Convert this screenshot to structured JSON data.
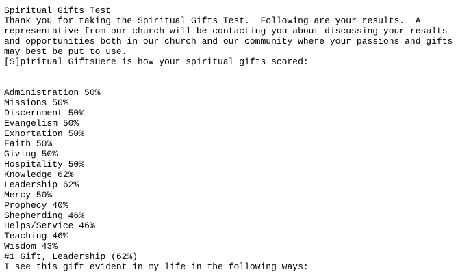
{
  "title": "Spiritual Gifts Test",
  "intro_lines": [
    "Thank you for taking the Spiritual Gifts Test.  Following are your results.  A",
    "representative from our church will be contacting you about discussing your results",
    "and opportunities both in our church and our community where your passions and gifts",
    "may best be put to use."
  ],
  "section_heading": "[S]piritual GiftsHere is how your spiritual gifts scored:",
  "gifts": [
    {
      "name": "Administration",
      "score": "50%",
      "text": "Administration 50%"
    },
    {
      "name": "Missions",
      "score": "50%",
      "text": "Missions 50%"
    },
    {
      "name": "Discernment",
      "score": "50%",
      "text": "Discernment 50%"
    },
    {
      "name": "Evangelism",
      "score": "50%",
      "text": "Evangelism 50%"
    },
    {
      "name": "Exhortation",
      "score": "50%",
      "text": "Exhortation 50%"
    },
    {
      "name": "Faith",
      "score": "50%",
      "text": "Faith 50%"
    },
    {
      "name": "Giving",
      "score": "50%",
      "text": "Giving 50%"
    },
    {
      "name": "Hospitality",
      "score": "50%",
      "text": "Hospitality 50%"
    },
    {
      "name": "Knowledge",
      "score": "62%",
      "text": "Knowledge 62%"
    },
    {
      "name": "Leadership",
      "score": "62%",
      "text": "Leadership 62%"
    },
    {
      "name": "Mercy",
      "score": "50%",
      "text": "Mercy 50%"
    },
    {
      "name": "Prophecy",
      "score": "40%",
      "text": "Prophecy 40%"
    },
    {
      "name": "Shepherding",
      "score": "46%",
      "text": "Shepherding 46%"
    },
    {
      "name": "Helps/Service",
      "score": "46%",
      "text": "Helps/Service 46%"
    },
    {
      "name": "Teaching",
      "score": "46%",
      "text": "Teaching 46%"
    },
    {
      "name": "Wisdom",
      "score": "43%",
      "text": "Wisdom 43%"
    }
  ],
  "top_gift": "#1 Gift, Leadership (62%)",
  "closing_line": "I see this gift evident in my life in the following ways:"
}
